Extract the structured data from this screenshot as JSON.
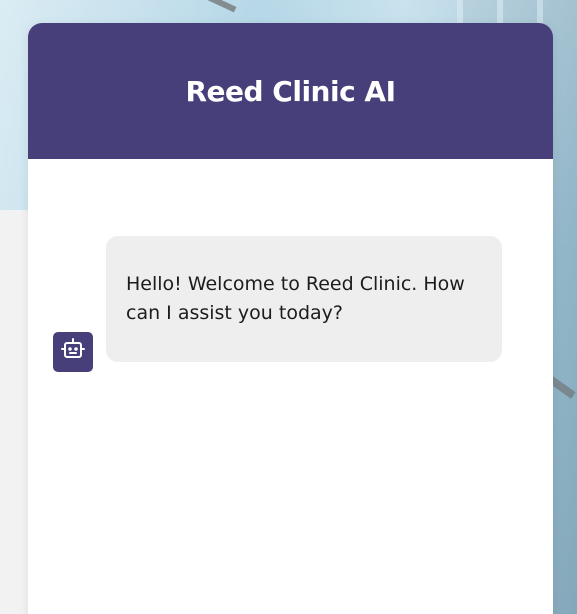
{
  "header": {
    "title": "Reed Clinic AI"
  },
  "messages": [
    {
      "sender": "bot",
      "avatar_icon": "robot-icon",
      "text": "Hello! Welcome to Reed Clinic. How can I assist you today?"
    }
  ],
  "colors": {
    "header_bg": "#473f7a",
    "bubble_bg": "#eeeeee",
    "text": "#1c1c1c",
    "window_bg": "#ffffff"
  }
}
